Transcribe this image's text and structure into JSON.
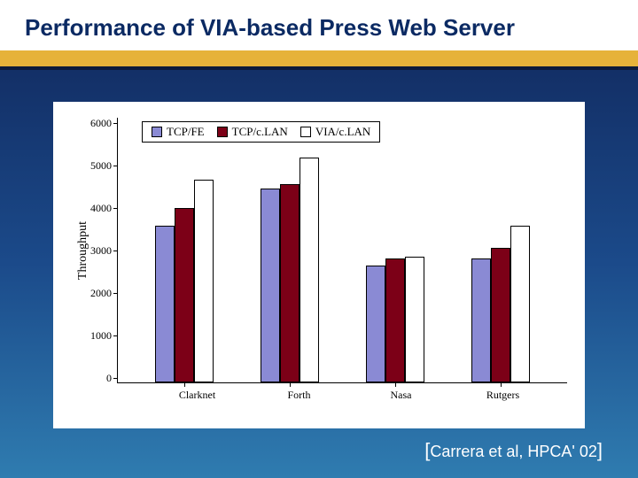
{
  "title": "Performance of VIA-based Press Web Server",
  "citation": {
    "open": "[",
    "text": "Carrera et al, HPCA' 02",
    "close": "]"
  },
  "chart_data": {
    "type": "bar",
    "title": "",
    "xlabel": "",
    "ylabel": "Throughput",
    "ylim": [
      0,
      6000
    ],
    "yticks": [
      0,
      1000,
      2000,
      3000,
      4000,
      5000,
      6000
    ],
    "categories": [
      "Clarknet",
      "Forth",
      "Nasa",
      "Rutgers"
    ],
    "series": [
      {
        "name": "TCP/FE",
        "values": [
          3550,
          4400,
          2650,
          2800
        ]
      },
      {
        "name": "TCP/c.LAN",
        "values": [
          3950,
          4500,
          2800,
          3050
        ]
      },
      {
        "name": "VIA/c.LAN",
        "values": [
          4600,
          5100,
          2850,
          3550
        ]
      }
    ],
    "legend_position": "top-left",
    "grid": false
  }
}
